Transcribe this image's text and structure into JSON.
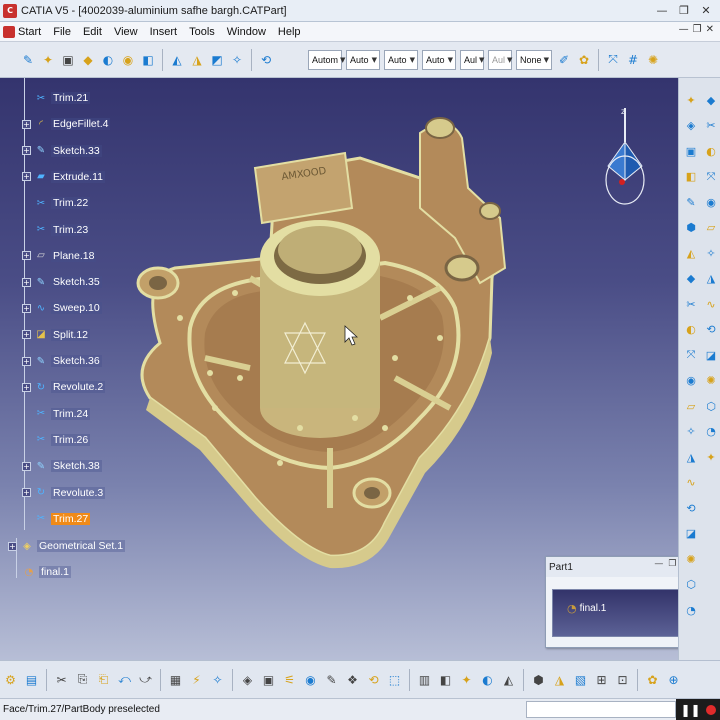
{
  "window": {
    "app_icon_text": "C",
    "title": "CATIA V5 - [4002039-aluminium safhe bargh.CATPart]",
    "controls": [
      "—",
      "❐",
      "✕"
    ]
  },
  "menubar": {
    "items": [
      "Start",
      "File",
      "Edit",
      "View",
      "Insert",
      "Tools",
      "Window",
      "Help"
    ],
    "mdi_controls": [
      "—",
      "❐",
      "✕"
    ]
  },
  "toolbar": {
    "combos": [
      {
        "value": "Autom",
        "dim": false
      },
      {
        "value": "Auto",
        "dim": false
      },
      {
        "value": "Auto",
        "dim": false
      },
      {
        "value": "Auto",
        "dim": false
      },
      {
        "value": "Aul",
        "dim": false
      },
      {
        "value": "Aul",
        "dim": true
      },
      {
        "value": "None",
        "dim": false
      }
    ]
  },
  "tree": {
    "items": [
      {
        "label": "Trim.21",
        "icon": "trim-icon",
        "expandable": false,
        "selected": false
      },
      {
        "label": "EdgeFillet.4",
        "icon": "fillet-icon",
        "expandable": true,
        "selected": false
      },
      {
        "label": "Sketch.33",
        "icon": "sketch-icon",
        "expandable": true,
        "selected": false
      },
      {
        "label": "Extrude.11",
        "icon": "extrude-icon",
        "expandable": true,
        "selected": false
      },
      {
        "label": "Trim.22",
        "icon": "trim-icon",
        "expandable": false,
        "selected": false
      },
      {
        "label": "Trim.23",
        "icon": "trim-icon",
        "expandable": false,
        "selected": false
      },
      {
        "label": "Plane.18",
        "icon": "plane-icon",
        "expandable": true,
        "selected": false
      },
      {
        "label": "Sketch.35",
        "icon": "sketch-icon",
        "expandable": true,
        "selected": false
      },
      {
        "label": "Sweep.10",
        "icon": "sweep-icon",
        "expandable": true,
        "selected": false
      },
      {
        "label": "Split.12",
        "icon": "split-icon",
        "expandable": true,
        "selected": false
      },
      {
        "label": "Sketch.36",
        "icon": "sketch-icon",
        "expandable": true,
        "selected": false
      },
      {
        "label": "Revolute.2",
        "icon": "revolute-icon",
        "expandable": true,
        "selected": false
      },
      {
        "label": "Trim.24",
        "icon": "trim-icon",
        "expandable": false,
        "selected": false
      },
      {
        "label": "Trim.26",
        "icon": "trim-icon",
        "expandable": false,
        "selected": false
      },
      {
        "label": "Sketch.38",
        "icon": "sketch-icon",
        "expandable": true,
        "selected": false
      },
      {
        "label": "Revolute.3",
        "icon": "revolute-icon",
        "expandable": true,
        "selected": false
      },
      {
        "label": "Trim.27",
        "icon": "trim-icon",
        "expandable": false,
        "selected": true
      }
    ],
    "geometrical_set": {
      "label": "Geometrical Set.1",
      "icon": "geometrical-set-icon"
    },
    "child": {
      "label": "final.1",
      "icon": "surface-icon"
    }
  },
  "compass": {
    "axis_label": "z"
  },
  "minipanel": {
    "title": "Part1",
    "controls": [
      "—",
      "❐",
      "✕"
    ],
    "item_label": "final.1"
  },
  "status": {
    "text": "Face/Trim.27/PartBody preselected",
    "pause_glyph": "❚❚"
  },
  "colors": {
    "viewport_top": "#34346e",
    "viewport_bottom": "#b7bed6",
    "part_fill": "#b38a5a",
    "part_edge": "#e3dea3",
    "selected_item": "#f08a18"
  }
}
